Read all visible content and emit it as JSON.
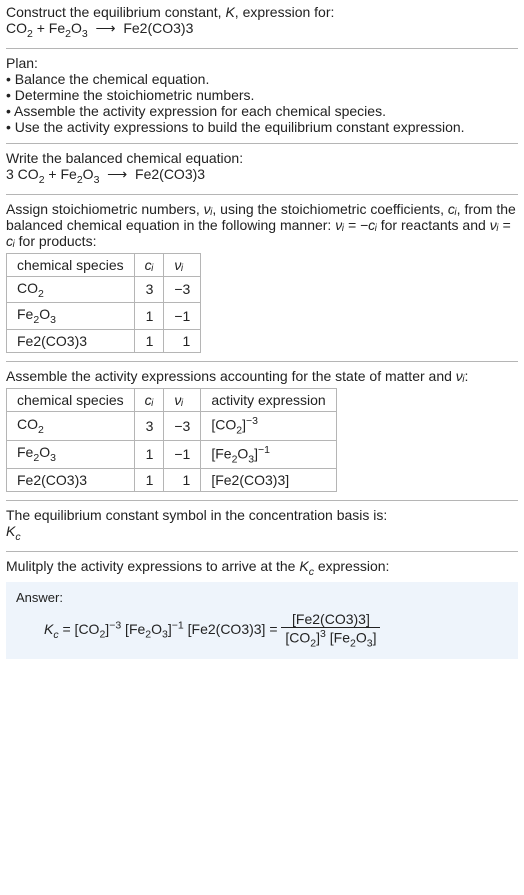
{
  "header": {
    "prompt": "Construct the equilibrium constant, K, expression for:",
    "equation": "CO₂ + Fe₂O₃ ⟶ Fe2(CO3)3"
  },
  "plan": {
    "title": "Plan:",
    "b1": "• Balance the chemical equation.",
    "b2": "• Determine the stoichiometric numbers.",
    "b3": "• Assemble the activity expression for each chemical species.",
    "b4": "• Use the activity expressions to build the equilibrium constant expression."
  },
  "balanced": {
    "title": "Write the balanced chemical equation:",
    "equation": "3 CO₂ + Fe₂O₃ ⟶ Fe2(CO3)3"
  },
  "stoich": {
    "text_part1": "Assign stoichiometric numbers, ",
    "text_part2": ", using the stoichiometric coefficients, ",
    "text_part3": ", from the balanced chemical equation in the following manner: ",
    "text_part4": " for reactants and ",
    "text_part5": " for products:",
    "num_i": "νᵢ",
    "c_i": "cᵢ",
    "rel_react": "νᵢ = −cᵢ",
    "rel_prod": "νᵢ = cᵢ",
    "head_species": "chemical species",
    "head_c": "cᵢ",
    "head_nu": "νᵢ",
    "rows": [
      {
        "species": "CO₂",
        "c": "3",
        "nu": "−3"
      },
      {
        "species": "Fe₂O₃",
        "c": "1",
        "nu": "−1"
      },
      {
        "species": "Fe2(CO3)3",
        "c": "1",
        "nu": "1"
      }
    ]
  },
  "activity": {
    "title_part1": "Assemble the activity expressions accounting for the state of matter and ",
    "title_part2": ":",
    "nu_i": "νᵢ",
    "head_species": "chemical species",
    "head_c": "cᵢ",
    "head_nu": "νᵢ",
    "head_expr": "activity expression",
    "rows": [
      {
        "species": "CO₂",
        "c": "3",
        "nu": "−3",
        "expr_html": "[CO<sub>2</sub>]<sup>−3</sup>"
      },
      {
        "species": "Fe₂O₃",
        "c": "1",
        "nu": "−1",
        "expr_html": "[Fe<sub>2</sub>O<sub>3</sub>]<sup>−1</sup>"
      },
      {
        "species": "Fe2(CO3)3",
        "c": "1",
        "nu": "1",
        "expr_html": "[Fe2(CO3)3]"
      }
    ]
  },
  "basis": {
    "line": "The equilibrium constant symbol in the concentration basis is:",
    "symbol": "K꜀"
  },
  "final": {
    "line": "Mulitply the activity expressions to arrive at the K꜀ expression:",
    "answer_label": "Answer:",
    "lhs": "K꜀ = ",
    "prod": "[CO₂]⁻³ [Fe₂O₃]⁻¹ [Fe2(CO3)3] = ",
    "frac_num": "[Fe2(CO3)3]",
    "frac_den": "[CO₂]³ [Fe₂O₃]"
  }
}
